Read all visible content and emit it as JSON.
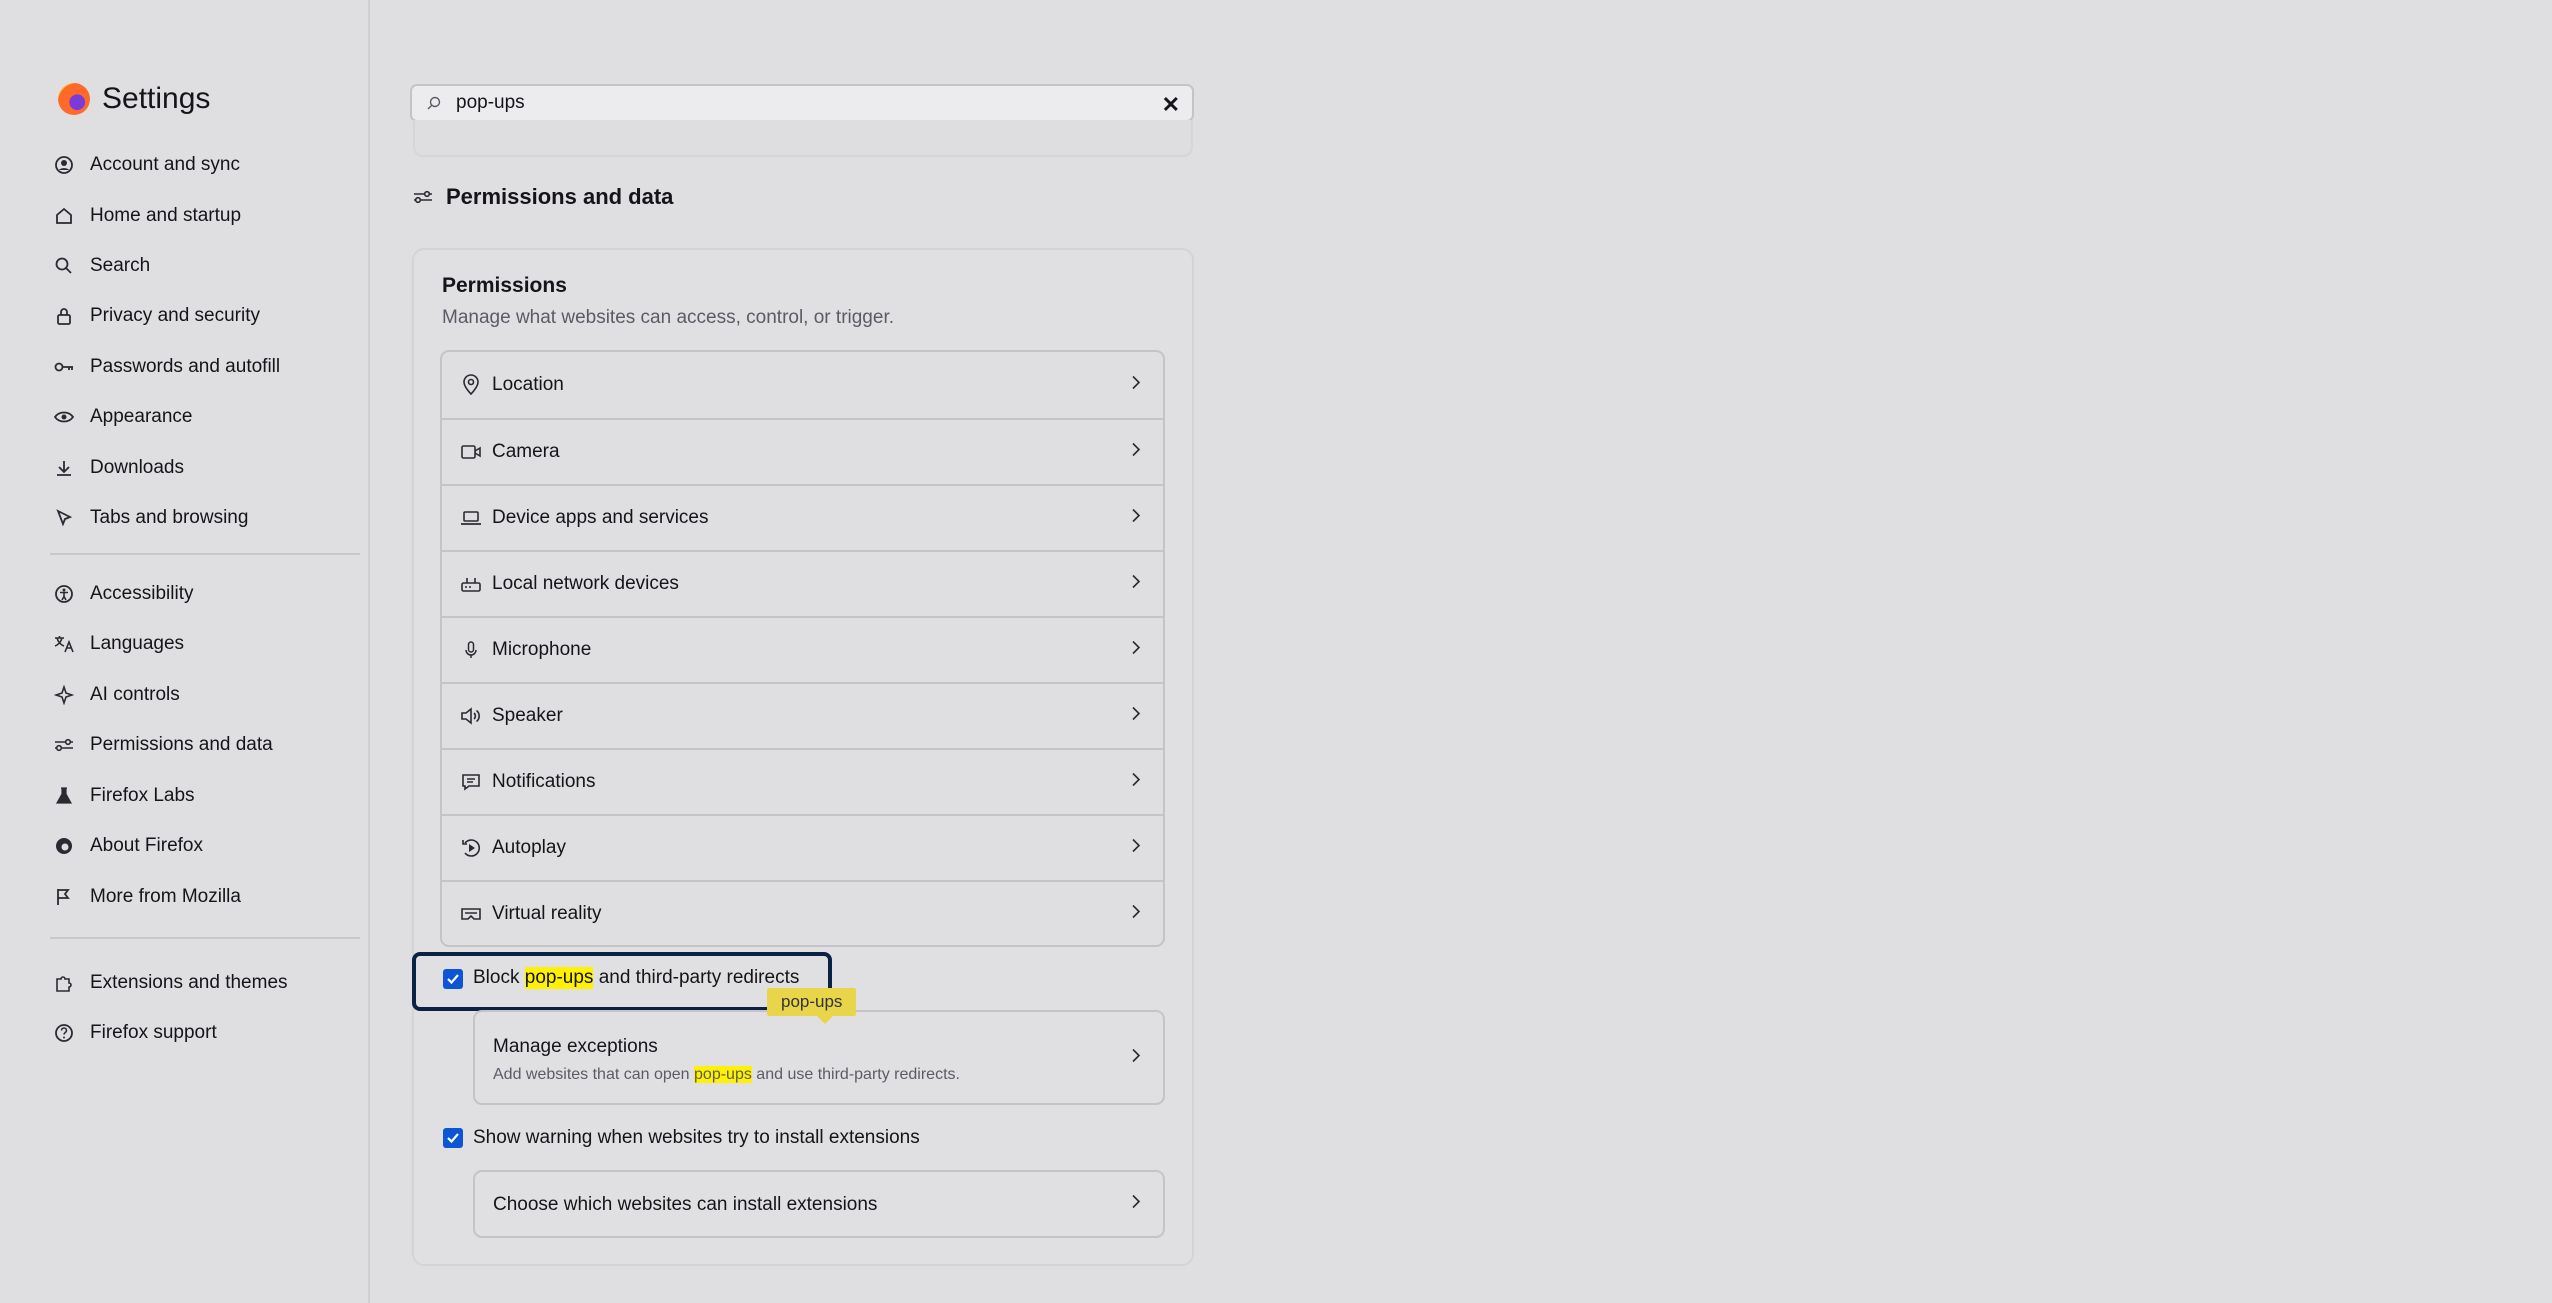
{
  "sidebar": {
    "title": "Settings",
    "items": [
      {
        "label": "Account and sync",
        "icon": "account-icon"
      },
      {
        "label": "Home and startup",
        "icon": "home-icon"
      },
      {
        "label": "Search",
        "icon": "search-icon"
      },
      {
        "label": "Privacy and security",
        "icon": "lock-icon"
      },
      {
        "label": "Passwords and autofill",
        "icon": "key-icon"
      },
      {
        "label": "Appearance",
        "icon": "eye-icon"
      },
      {
        "label": "Downloads",
        "icon": "download-icon"
      },
      {
        "label": "Tabs and browsing",
        "icon": "cursor-icon"
      },
      {
        "label": "Accessibility",
        "icon": "accessibility-icon"
      },
      {
        "label": "Languages",
        "icon": "translate-icon"
      },
      {
        "label": "AI controls",
        "icon": "sparkle-icon"
      },
      {
        "label": "Permissions and data",
        "icon": "sliders-icon"
      },
      {
        "label": "Firefox Labs",
        "icon": "flask-icon"
      },
      {
        "label": "About Firefox",
        "icon": "firefox-icon"
      },
      {
        "label": "More from Mozilla",
        "icon": "mozilla-icon"
      },
      {
        "label": "Extensions and themes",
        "icon": "puzzle-icon"
      },
      {
        "label": "Firefox support",
        "icon": "help-icon"
      }
    ]
  },
  "search": {
    "value": "pop-ups"
  },
  "section": {
    "title": "Permissions and data"
  },
  "permissions": {
    "title": "Permissions",
    "subtitle": "Manage what websites can access, control, or trigger.",
    "rows": [
      {
        "label": "Location",
        "icon": "location-icon"
      },
      {
        "label": "Camera",
        "icon": "camera-icon"
      },
      {
        "label": "Device apps and services",
        "icon": "laptop-icon"
      },
      {
        "label": "Local network devices",
        "icon": "router-icon"
      },
      {
        "label": "Microphone",
        "icon": "microphone-icon"
      },
      {
        "label": "Speaker",
        "icon": "speaker-icon"
      },
      {
        "label": "Notifications",
        "icon": "notification-icon"
      },
      {
        "label": "Autoplay",
        "icon": "autoplay-icon"
      },
      {
        "label": "Virtual reality",
        "icon": "vr-icon"
      }
    ]
  },
  "popups": {
    "checked": true,
    "label_before": "Block ",
    "label_highlight": "pop-ups",
    "label_after": " and third-party redirects",
    "tooltip": "pop-ups",
    "exceptions_title": "Manage exceptions",
    "exceptions_sub_before": "Add websites that can open ",
    "exceptions_sub_highlight": "pop-ups",
    "exceptions_sub_after": " and use third-party redirects."
  },
  "extensions": {
    "checked": true,
    "label": "Show warning when websites try to install extensions",
    "choose_label": "Choose which websites can install extensions"
  },
  "colors": {
    "accent": "#0c56d6",
    "highlight": "#fff200",
    "focus": "#0b2245"
  }
}
